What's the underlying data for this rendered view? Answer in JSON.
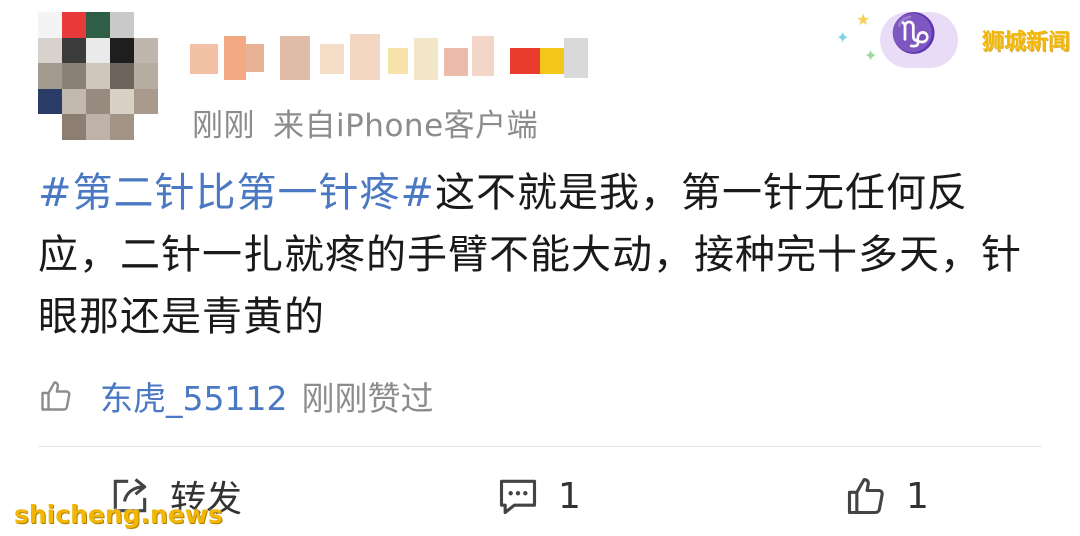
{
  "post": {
    "time": "刚刚",
    "source": "来自iPhone客户端",
    "hashtag": "#第二针比第一针疼#",
    "body": "这不就是我，第一针无任何反应，二针一扎就疼的手臂不能大动，接种完十多天，针眼那还是青黄的"
  },
  "liked_by": {
    "icon": "thumbs-up-icon",
    "user": "东虎_55112",
    "action": "刚刚赞过"
  },
  "actions": {
    "share_label": "转发",
    "share_icon": "share-icon",
    "comment_count": "1",
    "comment_icon": "comment-icon",
    "like_count": "1",
    "like_icon": "thumbs-up-icon"
  },
  "watermark": {
    "brand": "狮城新闻",
    "site": "shicheng.news",
    "color": "#f2b705"
  },
  "colors": {
    "link": "#4a78c2",
    "muted": "#8c8c8c",
    "text": "#1a1a1a"
  }
}
